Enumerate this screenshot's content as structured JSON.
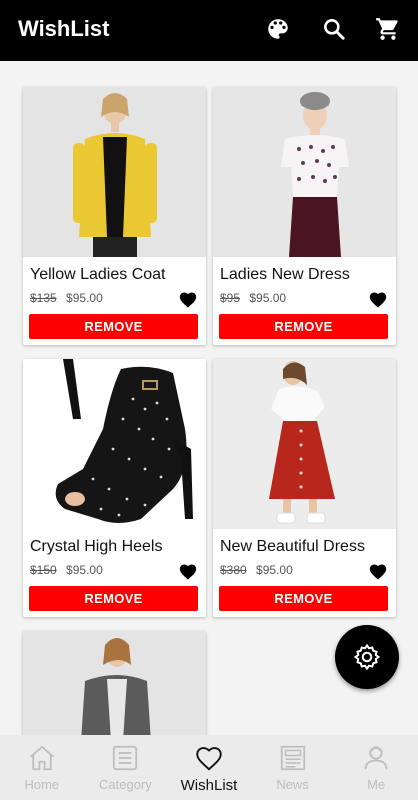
{
  "appbar": {
    "title": "WishList",
    "actions": [
      "palette-icon",
      "search-icon",
      "cart-icon"
    ]
  },
  "products": [
    {
      "name": "Yellow Ladies Coat",
      "old_price": "$135",
      "price": "$95.00",
      "remove_label": "REMOVE"
    },
    {
      "name": "Ladies New Dress",
      "old_price": "$95",
      "price": "$95.00",
      "remove_label": "REMOVE"
    },
    {
      "name": "Crystal High Heels",
      "old_price": "$150",
      "price": "$95.00",
      "remove_label": "REMOVE"
    },
    {
      "name": "New Beautiful Dress",
      "old_price": "$380",
      "price": "$95.00",
      "remove_label": "REMOVE"
    }
  ],
  "fab": {
    "icon": "settings-icon"
  },
  "bottom_nav": [
    {
      "label": "Home",
      "icon": "home-icon",
      "active": false
    },
    {
      "label": "Category",
      "icon": "list-icon",
      "active": false
    },
    {
      "label": "WishList",
      "icon": "heart-outline-icon",
      "active": true
    },
    {
      "label": "News",
      "icon": "newspaper-icon",
      "active": false
    },
    {
      "label": "Me",
      "icon": "person-icon",
      "active": false
    }
  ],
  "colors": {
    "appbar": "#000000",
    "accent": "#ff0000",
    "nav_active": "#111111",
    "nav_inactive": "#bdbdbd"
  }
}
